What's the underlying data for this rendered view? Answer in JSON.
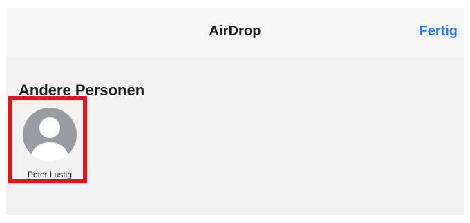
{
  "navbar": {
    "title": "AirDrop",
    "done_label": "Fertig"
  },
  "section": {
    "title": "Andere Personen"
  },
  "contacts": [
    {
      "name": "Peter Lustig",
      "avatar_icon": "person-silhouette-icon"
    }
  ],
  "colors": {
    "accent": "#2f7bf6",
    "highlight": "#e3141b",
    "avatar_bg": "#9a9aa3"
  }
}
